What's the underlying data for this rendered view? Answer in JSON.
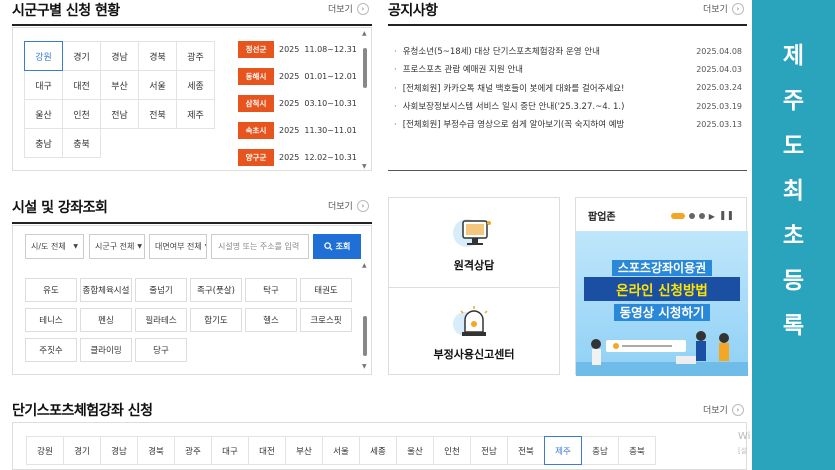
{
  "region_section": {
    "title": "시군구별 신청 현황",
    "more": "더보기",
    "regions": [
      "강원",
      "경기",
      "경남",
      "경북",
      "광주",
      "대구",
      "대전",
      "부산",
      "서울",
      "세종",
      "울산",
      "인천",
      "전남",
      "전북",
      "제주",
      "충남",
      "충북"
    ],
    "active": "강원",
    "schedule": [
      {
        "city": "정선군",
        "year": "2025",
        "period": "11.08~12.31"
      },
      {
        "city": "동해시",
        "year": "2025",
        "period": "01.01~12.01"
      },
      {
        "city": "삼척시",
        "year": "2025",
        "period": "03.10~10.31"
      },
      {
        "city": "속초시",
        "year": "2025",
        "period": "11.30~11.01"
      },
      {
        "city": "양구군",
        "year": "2025",
        "period": "12.02~10.31"
      }
    ]
  },
  "notice_section": {
    "title": "공지사항",
    "more": "더보기",
    "items": [
      {
        "text": "유청소년(5~18세) 대상 단기스포츠체험강좌 운영 안내",
        "date": "2025.04.08"
      },
      {
        "text": "프로스포츠 관람 예매권 지원 안내",
        "date": "2025.04.03"
      },
      {
        "text": "[전체회원] 카카오톡 채널 백호들이 봇에게 대화를 걸어주세요!",
        "date": "2025.03.24"
      },
      {
        "text": "사회보장정보시스템 서비스 일시 중단 안내('25.3.27.~4. 1.)",
        "date": "2025.03.19"
      },
      {
        "text": "[전체회원] 부정수급 영상으로 쉽게 알아보기(꼭 숙지하여 예방",
        "date": "2025.03.13"
      }
    ]
  },
  "facility_section": {
    "title": "시설 및 강좌조회",
    "more": "더보기",
    "selects": [
      "시/도 전체",
      "시군구 전체",
      "대면여부 전체"
    ],
    "search_placeholder": "시설명 또는 주소를 입력",
    "search_button": "조회",
    "sports": [
      "유도",
      "종합체육시설",
      "줄넘기",
      "족구(풋살)",
      "탁구",
      "태권도",
      "테니스",
      "펜싱",
      "필라테스",
      "합기도",
      "헬스",
      "크로스핏",
      "주짓수",
      "클라이밍",
      "당구"
    ]
  },
  "cards": {
    "remote": "원격상담",
    "report": "부정사용신고센터"
  },
  "popup": {
    "title": "팝업존",
    "line1": "스포츠강좌이용권",
    "line2": "온라인 신청방법",
    "line3": "동영상 시청하기",
    "colors": {
      "accent": "#f5a623",
      "banner_bg": "#8fd0f5",
      "highlight": "#ffe400"
    }
  },
  "bottom_section": {
    "title": "단기스포츠체험강좌 신청",
    "more": "더보기",
    "regions": [
      "강원",
      "경기",
      "경남",
      "경북",
      "광주",
      "대구",
      "대전",
      "부산",
      "서울",
      "세종",
      "울산",
      "인천",
      "전남",
      "전북",
      "제주",
      "충남",
      "충북"
    ],
    "active": "제주"
  },
  "side_banner": {
    "chars": [
      "제",
      "주",
      "도",
      "최",
      "초",
      "등",
      "록"
    ],
    "color": "#2aa3bd"
  },
  "watermark": {
    "line1": "Wi",
    "line2": "[설"
  }
}
